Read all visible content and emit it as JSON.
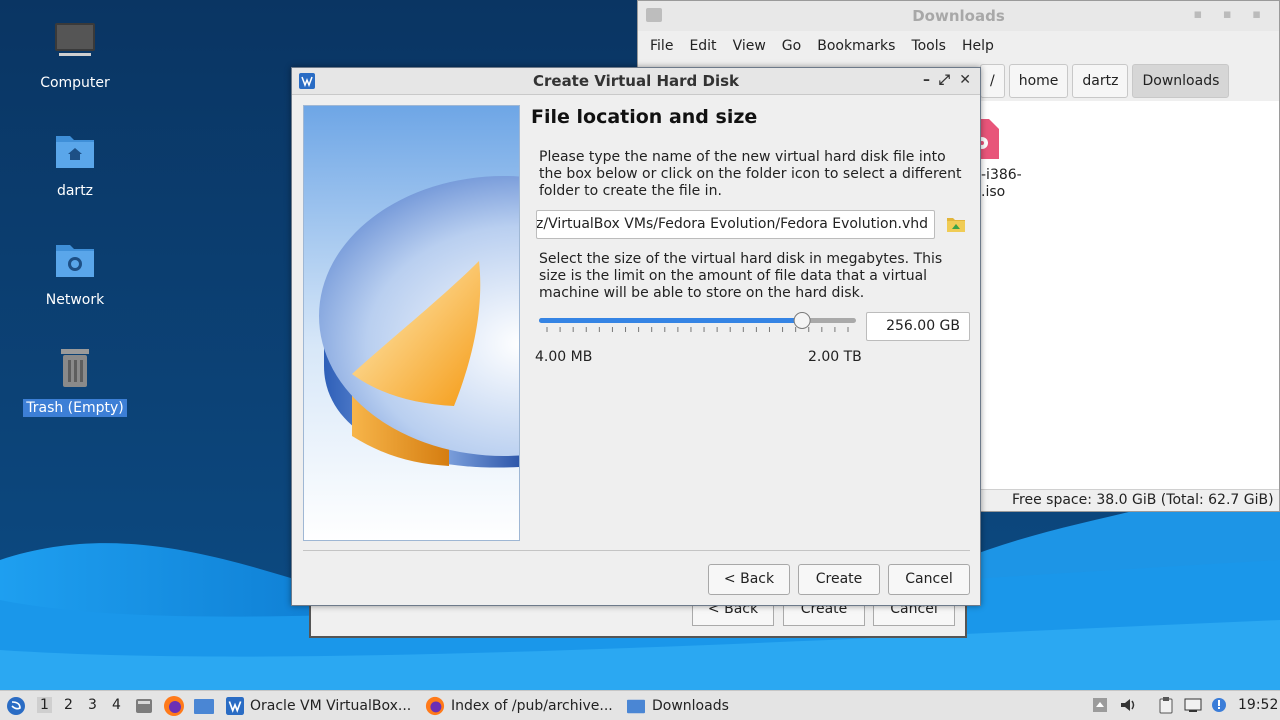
{
  "desktop": {
    "icons": [
      {
        "label": "Computer"
      },
      {
        "label": "dartz"
      },
      {
        "label": "Network"
      },
      {
        "label": "Trash (Empty)"
      }
    ]
  },
  "file_manager": {
    "title": "Downloads",
    "menu": [
      "File",
      "Edit",
      "View",
      "Go",
      "Bookmarks",
      "Tools",
      "Help"
    ],
    "path_root": "/",
    "breadcrumbs": [
      "home",
      "dartz",
      "Downloads"
    ],
    "partial_file_label_line1": "-i386-",
    "partial_file_label_line2": ".iso",
    "status": "Free space: 38.0 GiB (Total: 62.7 GiB)"
  },
  "background_wizard": {
    "back_label": "< Back",
    "create_label": "Create",
    "cancel_label": "Cancel"
  },
  "dialog": {
    "title": "Create Virtual Hard Disk",
    "heading": "File location and size",
    "location_description": "Please type the name of the new virtual hard disk file into the box below or click on the folder icon to select a different folder to create the file in.",
    "file_path_visible": "z/VirtualBox VMs/Fedora Evolution/Fedora Evolution.vhd",
    "size_description": "Select the size of the virtual hard disk in megabytes. This size is the limit on the amount of file data that a virtual machine will be able to store on the hard disk.",
    "size_value": "256.00 GB",
    "slider_min_label": "4.00 MB",
    "slider_max_label": "2.00 TB",
    "slider_fraction": 0.83,
    "back_label": "< Back",
    "create_label": "Create",
    "cancel_label": "Cancel"
  },
  "taskbar": {
    "workspaces": [
      "1",
      "2",
      "3",
      "4"
    ],
    "tasks": [
      {
        "label": "Oracle VM VirtualBox...",
        "icon": "virtualbox-icon"
      },
      {
        "label": "Index of /pub/archive...",
        "icon": "firefox-icon"
      },
      {
        "label": "Downloads",
        "icon": "folder-icon"
      }
    ],
    "clock": "19:52"
  },
  "colors": {
    "accent": "#3d7fd6",
    "slider_fill": "#3584e4",
    "desktop_dark": "#0b3b6e",
    "desktop_light": "#1a9be6"
  }
}
